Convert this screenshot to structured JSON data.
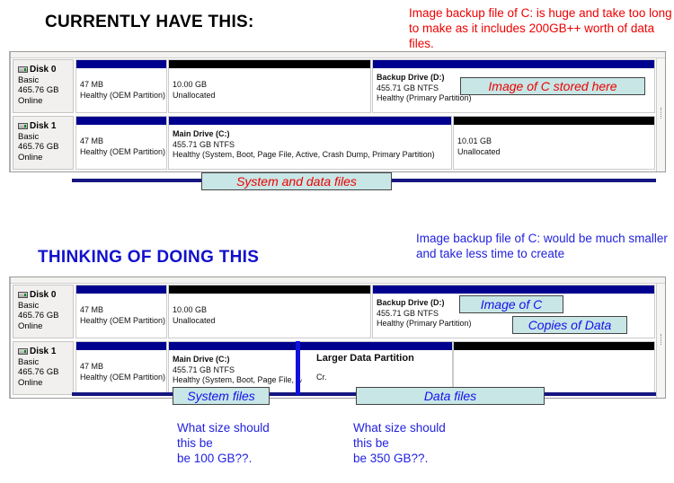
{
  "headings": {
    "current": "CURRENTLY HAVE THIS:",
    "proposed": "THINKING OF DOING THIS"
  },
  "annotations": {
    "red_top": "Image backup file of C: is huge and take too long to make as it includes 200GB++ worth of data files.",
    "blue_mid": "Image backup file of C: would be much smaller and take less time to create",
    "question_left": "What size should this be 100 GB??.",
    "question_right": "What size should this be 350 GB??."
  },
  "callouts": {
    "image_of_c_stored_here": "Image of C stored here",
    "system_and_data_files": "System and data files",
    "image_of_c": "Image of C",
    "copies_of_data": "Copies of Data",
    "system_files": "System files",
    "data_files": "Data files"
  },
  "colors": {
    "partition_blue": "#00008f",
    "partition_black": "#000000",
    "callout_fill": "#c8e6e6",
    "annotation_red": "#ee0000",
    "annotation_blue": "#2222e0",
    "split_divider": "#1111dd"
  },
  "panel_current": {
    "disks": [
      {
        "name": "Disk 0",
        "type": "Basic",
        "size": "465.76 GB",
        "status": "Online",
        "partitions": [
          {
            "bar": "blue",
            "title": "",
            "line1": "47 MB",
            "line2": "Healthy (OEM Partition)"
          },
          {
            "bar": "black",
            "title": "",
            "line1": "10.00 GB",
            "line2": "Unallocated"
          },
          {
            "bar": "blue",
            "title": "Backup Drive  (D:)",
            "line1": "455.71 GB NTFS",
            "line2": "Healthy (Primary Partition)"
          }
        ]
      },
      {
        "name": "Disk 1",
        "type": "Basic",
        "size": "465.76 GB",
        "status": "Online",
        "partitions": [
          {
            "bar": "blue",
            "title": "",
            "line1": "47 MB",
            "line2": "Healthy (OEM Partition)"
          },
          {
            "bar": "blue",
            "title": "Main Drive  (C:)",
            "line1": "455.71 GB NTFS",
            "line2": "Healthy (System, Boot, Page File, Active, Crash Dump, Primary Partition)"
          },
          {
            "bar": "black",
            "title": "",
            "line1": "10.01 GB",
            "line2": "Unallocated"
          }
        ]
      }
    ]
  },
  "panel_proposed": {
    "disks": [
      {
        "name": "Disk 0",
        "type": "Basic",
        "size": "465.76 GB",
        "status": "Online",
        "partitions": [
          {
            "bar": "blue",
            "title": "",
            "line1": "47 MB",
            "line2": "Healthy (OEM Partition)"
          },
          {
            "bar": "black",
            "title": "",
            "line1": "10.00 GB",
            "line2": "Unallocated"
          },
          {
            "bar": "blue",
            "title": "Backup Drive  (D:)",
            "line1": "455.71 GB NTFS",
            "line2": "Healthy (Primary Partition)"
          }
        ]
      },
      {
        "name": "Disk 1",
        "type": "Basic",
        "size": "465.76 GB",
        "status": "Online",
        "partitions": [
          {
            "bar": "blue",
            "title": "",
            "line1": "47 MB",
            "line2": "Healthy (OEM Partition)"
          },
          {
            "bar": "blue",
            "title": "Main Drive  (C:)",
            "line1": "455.71 GB NTFS",
            "line2": "Healthy (System, Boot, Page File, Active,"
          },
          {
            "bar": "blue",
            "title": "Larger Data Partition",
            "line1": "Cr.",
            "line2": ""
          },
          {
            "bar": "black",
            "title": "",
            "line1": "",
            "line2": ""
          }
        ]
      }
    ]
  }
}
